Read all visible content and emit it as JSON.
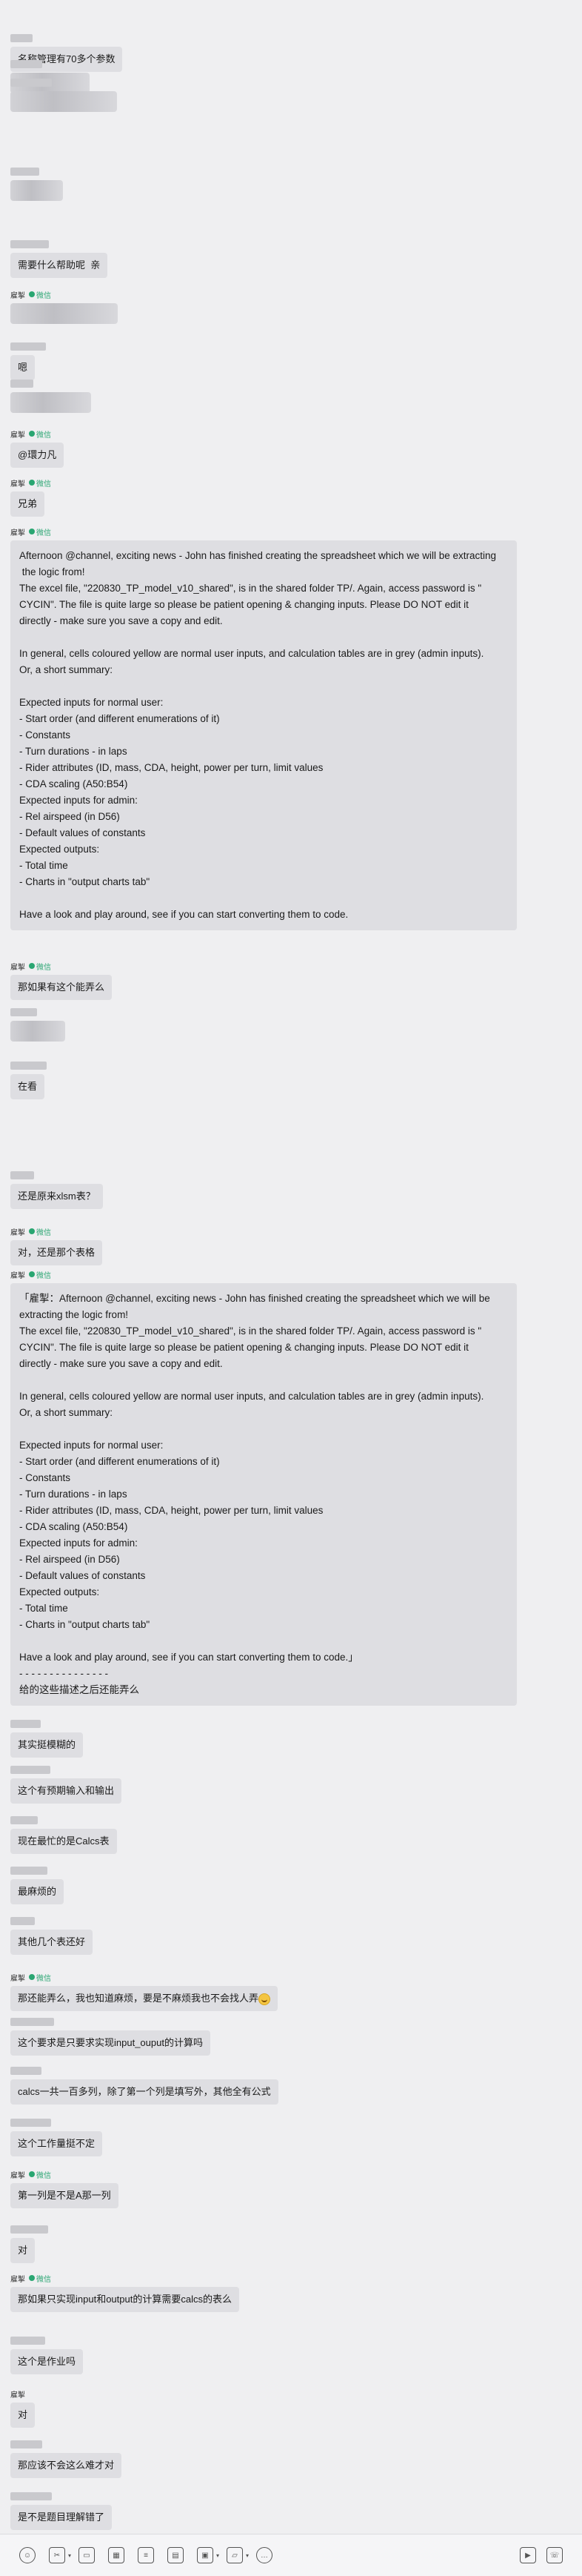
{
  "colors": {
    "background": "#efeff1",
    "bubble": "#dedee2",
    "badge": "#2aa672"
  },
  "badge_text": "微信",
  "messages": [
    {
      "sender": "",
      "badge": false,
      "text": "名称管理有70多个参数"
    },
    {
      "sender": "",
      "badge": false,
      "text": ""
    },
    {
      "sender": "",
      "badge": false,
      "text": ""
    },
    {
      "sender": "",
      "badge": false,
      "text": ""
    },
    {
      "sender": "",
      "badge": false,
      "text": "需要什么帮助呢  亲"
    },
    {
      "sender": "雇掣",
      "badge": true,
      "text": ""
    },
    {
      "sender": "",
      "badge": false,
      "text": "嗯"
    },
    {
      "sender": "",
      "badge": false,
      "text": ""
    },
    {
      "sender": "雇掣",
      "badge": true,
      "text": "@環力凡"
    },
    {
      "sender": "雇掣",
      "badge": true,
      "text": "兄弟"
    },
    {
      "sender": "雇掣",
      "badge": true,
      "text": "Afternoon @channel, exciting news - John has finished creating the spreadsheet which we will be extracting\n the logic from!\nThe excel file, \"220830_TP_model_v10_shared\", is in the shared folder TP/. Again, access password is \"\nCYCIN\". The file is quite large so please be patient opening & changing inputs. Please DO NOT edit it\ndirectly - make sure you save a copy and edit.\n\nIn general, cells coloured yellow are normal user inputs, and calculation tables are in grey (admin inputs).\nOr, a short summary:\n\nExpected inputs for normal user:\n- Start order (and different enumerations of it)\n- Constants\n- Turn durations - in laps\n- Rider attributes (ID, mass, CDA, height, power per turn, limit values\n- CDA scaling (A50:B54)\nExpected inputs for admin:\n- Rel airspeed (in D56)\n- Default values of constants\nExpected outputs:\n- Total time\n- Charts in \"output charts tab\"\n\nHave a look and play around, see if you can start converting them to code."
    },
    {
      "sender": "雇掣",
      "badge": true,
      "text": "那如果有这个能弄么"
    },
    {
      "sender": "",
      "badge": false,
      "text": ""
    },
    {
      "sender": "",
      "badge": false,
      "text": "在看"
    },
    {
      "sender": "",
      "badge": false,
      "text": "还是原来xlsm表？"
    },
    {
      "sender": "雇掣",
      "badge": true,
      "text": "对，还是那个表格"
    },
    {
      "sender": "雇掣",
      "badge": true,
      "text": "「雇掣：Afternoon @channel, exciting news - John has finished creating the spreadsheet which we will be\nextracting the logic from!\nThe excel file, \"220830_TP_model_v10_shared\", is in the shared folder TP/. Again, access password is \"\nCYCIN\". The file is quite large so please be patient opening & changing inputs. Please DO NOT edit it\ndirectly - make sure you save a copy and edit.\n\nIn general, cells coloured yellow are normal user inputs, and calculation tables are in grey (admin inputs).\nOr, a short summary:\n\nExpected inputs for normal user:\n- Start order (and different enumerations of it)\n- Constants\n- Turn durations - in laps\n- Rider attributes (ID, mass, CDA, height, power per turn, limit values\n- CDA scaling (A50:B54)\nExpected inputs for admin:\n- Rel airspeed (in D56)\n- Default values of constants\nExpected outputs:\n- Total time\n- Charts in \"output charts tab\"\n\nHave a look and play around, see if you can start converting them to code.」\n- - - - - - - - - - - - - - -\n给的这些描述之后还能弄么"
    },
    {
      "sender": "",
      "badge": false,
      "text": "其实挺模糊的"
    },
    {
      "sender": "",
      "badge": false,
      "text": "这个有预期输入和输出"
    },
    {
      "sender": "",
      "badge": false,
      "text": "现在最忙的是Calcs表"
    },
    {
      "sender": "",
      "badge": false,
      "text": "最麻烦的"
    },
    {
      "sender": "",
      "badge": false,
      "text": "其他几个表还好"
    },
    {
      "sender": "雇掣",
      "badge": true,
      "text": "那还能弄么，我也知道麻烦，要是不麻烦我也不会找人弄"
    },
    {
      "sender": "",
      "badge": false,
      "text": "这个要求是只要求实现input_ouput的计算吗"
    },
    {
      "sender": "",
      "badge": false,
      "text": "calcs一共一百多列，除了第一个列是填写外，其他全有公式"
    },
    {
      "sender": "",
      "badge": false,
      "text": "这个工作量挺不定"
    },
    {
      "sender": "雇掣",
      "badge": true,
      "text": "第一列是不是A那一列"
    },
    {
      "sender": "",
      "badge": false,
      "text": "对"
    },
    {
      "sender": "雇掣",
      "badge": true,
      "text": "那如果只实现input和output的计算需要calcs的表么"
    },
    {
      "sender": "",
      "badge": false,
      "text": "这个是作业吗"
    },
    {
      "sender": "雇掣",
      "badge": false,
      "text": "对"
    },
    {
      "sender": "",
      "badge": false,
      "text": "那应该不会这么难才对"
    },
    {
      "sender": "",
      "badge": false,
      "text": "是不是题目理解错了"
    }
  ],
  "toolbar": {
    "left": [
      "emoji-icon",
      "scissors-icon",
      "folder-icon",
      "image-icon",
      "document-icon",
      "card-icon",
      "gallery-icon",
      "folder2-icon",
      "bubble-icon"
    ],
    "right": [
      "video-icon",
      "call-icon"
    ]
  }
}
